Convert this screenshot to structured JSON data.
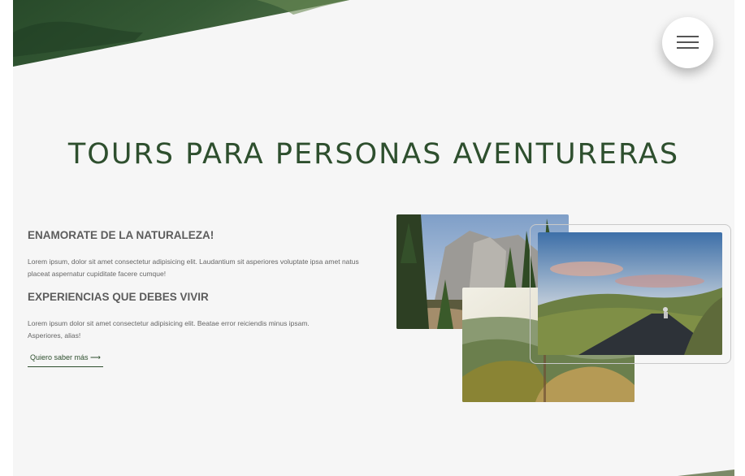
{
  "menu": {
    "icon": "hamburger-icon"
  },
  "title": "TOURS PARA PERSONAS AVENTURERAS",
  "section1": {
    "heading": "ENAMORATE DE LA NATURALEZA!",
    "body": "Lorem ipsum, dolor sit amet consectetur adipisicing elit. Laudantium sit asperiores voluptate ipsa amet natus placeat aspernatur cupiditate facere cumque!"
  },
  "section2": {
    "heading": "EXPERIENCIAS QUE DEBES VIVIR",
    "body": "Lorem ipsum dolor sit amet consectetur adipisicing elit. Beatae error reiciendis minus ipsam. Asperiores, alias!"
  },
  "cta": {
    "label": "Quiero saber más ⟶"
  },
  "colors": {
    "accent": "#2e4f2e",
    "background": "#f6f6f6",
    "hero_green": "#3b5e3b"
  }
}
